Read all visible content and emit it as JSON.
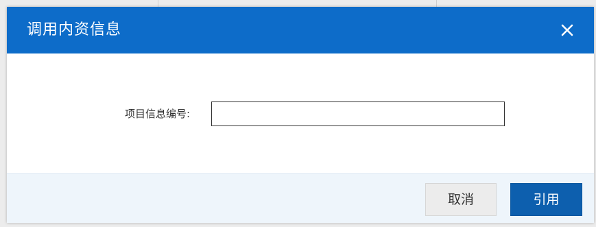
{
  "dialog": {
    "title": "调用内资信息",
    "close_icon": "close-icon"
  },
  "form": {
    "project_number_label": "项目信息编号:",
    "project_number_value": "",
    "project_number_placeholder": ""
  },
  "footer": {
    "cancel_label": "取消",
    "reference_label": "引用"
  },
  "colors": {
    "header_bg": "#0d6cc9",
    "primary_button": "#0d5fae",
    "footer_bg": "#eef5fb"
  }
}
